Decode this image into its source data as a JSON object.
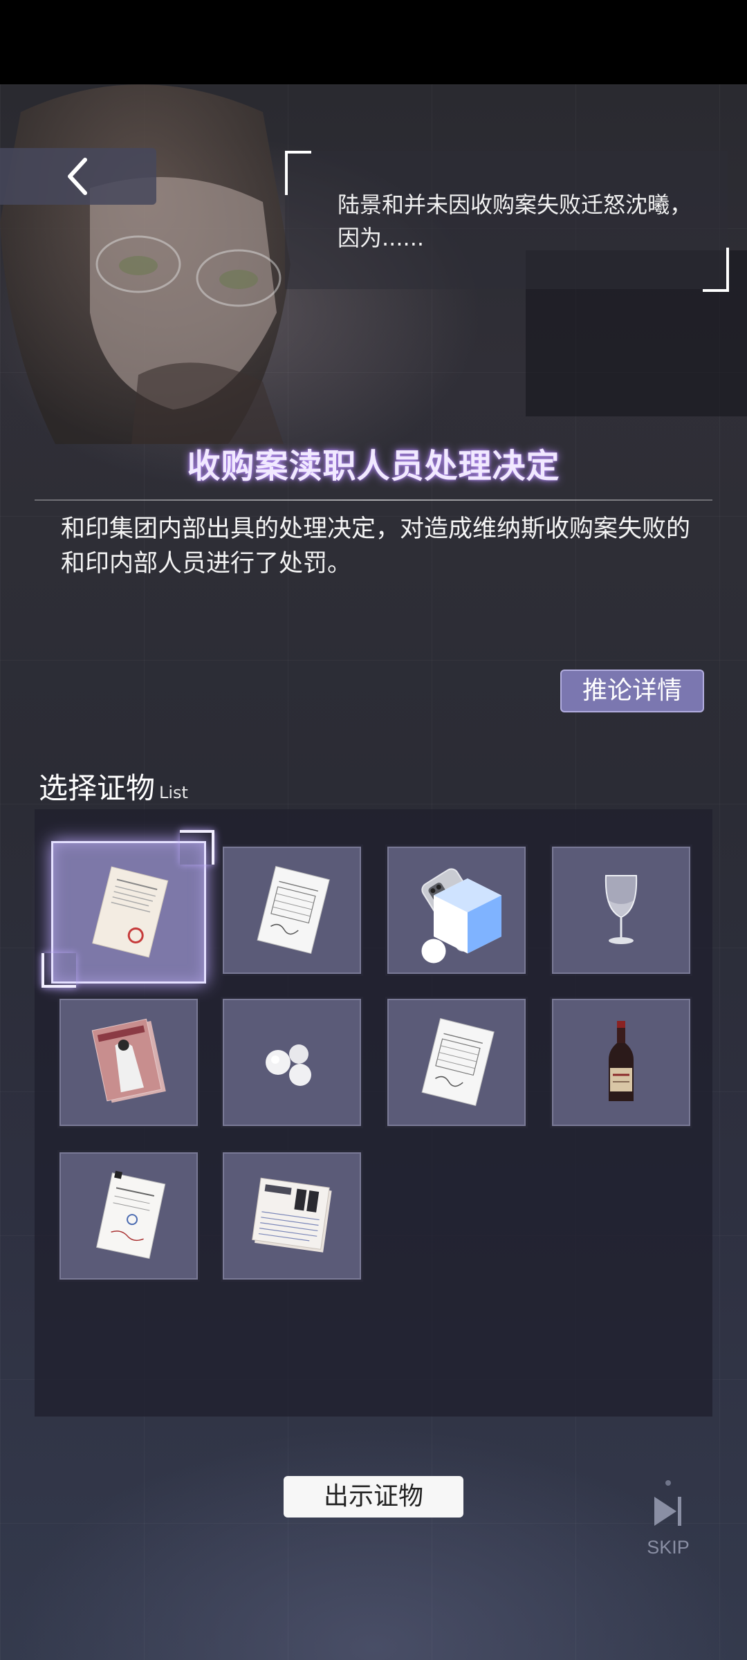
{
  "back_button": {
    "icon": "chevron-left-icon"
  },
  "dialogue": {
    "text": "陆景和并未因收购案失败迁怒沈曦，因为......"
  },
  "document": {
    "title": "收购案渎职人员处理决定",
    "description": "和印集团内部出具的处理决定，对造成维纳斯收购案失败的和印内部人员进行了处罚。",
    "detail_button": "推论详情"
  },
  "evidence": {
    "title": "选择证物",
    "subtitle": "List",
    "items": [
      {
        "icon": "document-with-stamp-icon",
        "selected": true
      },
      {
        "icon": "document-01-icon"
      },
      {
        "icon": "smartphone-icon",
        "badge": "cube-icon"
      },
      {
        "icon": "wine-glass-icon"
      },
      {
        "icon": "magazine-icon"
      },
      {
        "icon": "cotton-balls-icon"
      },
      {
        "icon": "document-02-icon"
      },
      {
        "icon": "wine-bottle-icon"
      },
      {
        "icon": "handwritten-note-icon"
      },
      {
        "icon": "newspaper-icon"
      }
    ]
  },
  "actions": {
    "show_evidence": "出示证物",
    "skip_label": "SKIP"
  },
  "colors": {
    "accent": "#7b77b0",
    "title_glow": "#b99bff",
    "slot_bg": "#5b5b78",
    "panel_bg": "#1e1f2c"
  }
}
